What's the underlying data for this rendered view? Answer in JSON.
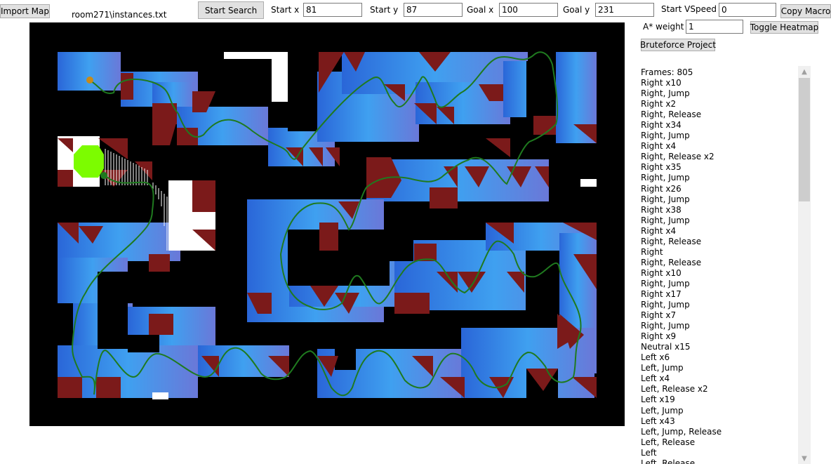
{
  "toolbar": {
    "import_label": "Import Map",
    "file_name": "room271\\instances.txt",
    "start_search_label": "Start Search",
    "start_x_label": "Start x",
    "start_x_value": "81",
    "start_y_label": "Start y",
    "start_y_value": "87",
    "goal_x_label": "Goal x",
    "goal_x_value": "100",
    "goal_y_label": "Goal y",
    "goal_y_value": "231",
    "start_vspeed_label": "Start VSpeed",
    "start_vspeed_value": "0",
    "copy_macro_label": "Copy Macro",
    "astar_label": "A* weight",
    "astar_value": "1",
    "heatmap_label": "Toggle Heatmap",
    "bruteforce_label": "Bruteforce Project"
  },
  "map": {
    "colors": {
      "background": "#000000",
      "hazard": "#7b1a1a",
      "explored": "#3a7fe0",
      "path": "#1f7a1f",
      "start_marker": "#c78a1a",
      "goal_marker": "#7cfc00",
      "open_space": "#ffffff"
    }
  },
  "log": {
    "lines": [
      "Frames: 805",
      "Right x10",
      "Right, Jump",
      "Right x2",
      "Right, Release",
      "Right x34",
      "Right, Jump",
      "Right x4",
      "Right, Release x2",
      "Right x35",
      "Right, Jump",
      "Right x26",
      "Right, Jump",
      "Right x38",
      "Right, Jump",
      "Right x4",
      "Right, Release",
      "Right",
      "Right, Release",
      "Right x10",
      "Right, Jump",
      "Right x17",
      "Right, Jump",
      "Right x7",
      "Right, Jump",
      "Right x9",
      "Neutral x15",
      "Left x6",
      "Left, Jump",
      "Left x4",
      "Left, Release x2",
      "Left x19",
      "Left, Jump",
      "Left x43",
      "Left, Jump, Release",
      "Left, Release",
      "Left",
      "Left, Release"
    ]
  },
  "scrollbar": {
    "up_icon": "▲",
    "down_icon": "▼"
  }
}
